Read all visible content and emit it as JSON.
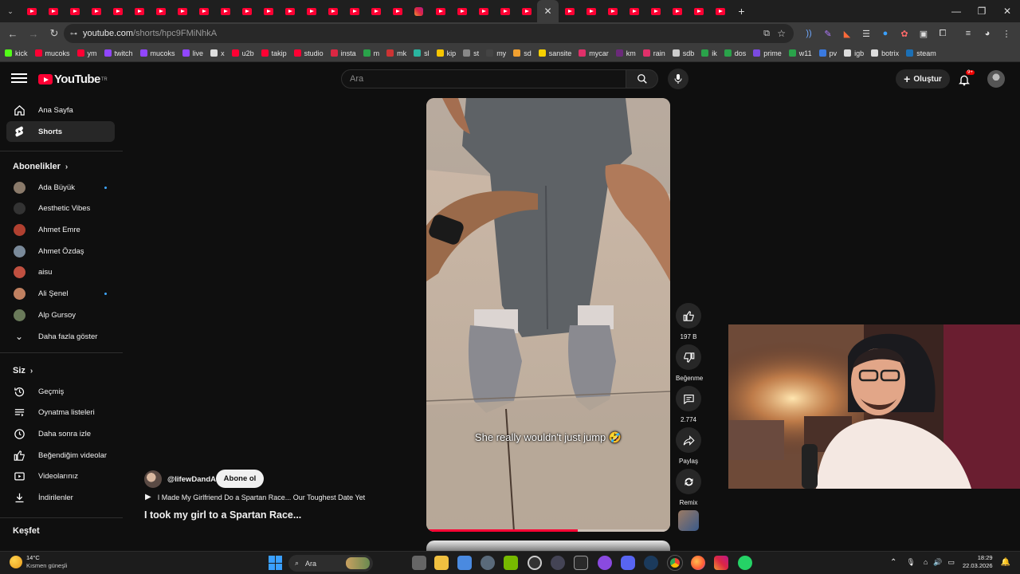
{
  "browser": {
    "tab_count_youtube": 32,
    "active_tab_close": "✕",
    "new_tab": "+",
    "window_controls": {
      "minimize": "—",
      "maximize": "❐",
      "close": "✕"
    },
    "url_host": "youtube.com",
    "url_path": "/shorts/hpc9FMiNhkA"
  },
  "bookmarks": [
    {
      "label": "kick",
      "color": "#53fc18"
    },
    {
      "label": "mucoks",
      "color": "#ff0033"
    },
    {
      "label": "ym",
      "color": "#ff0033"
    },
    {
      "label": "twitch",
      "color": "#9146ff"
    },
    {
      "label": "mucoks",
      "color": "#9146ff"
    },
    {
      "label": "live",
      "color": "#9146ff"
    },
    {
      "label": "x",
      "color": "#dddddd"
    },
    {
      "label": "u2b",
      "color": "#ff0033"
    },
    {
      "label": "takip",
      "color": "#ff0033"
    },
    {
      "label": "studio",
      "color": "#ff0033"
    },
    {
      "label": "insta",
      "color": "#dc2743"
    },
    {
      "label": "m",
      "color": "#2aa34a"
    },
    {
      "label": "mk",
      "color": "#c33"
    },
    {
      "label": "sl",
      "color": "#2ab5a0"
    },
    {
      "label": "kip",
      "color": "#f7c600"
    },
    {
      "label": "st",
      "color": "#888888"
    },
    {
      "label": "my",
      "color": "#444444"
    },
    {
      "label": "sd",
      "color": "#f0a030"
    },
    {
      "label": "sansite",
      "color": "#f7d100"
    },
    {
      "label": "mycar",
      "color": "#e0306a"
    },
    {
      "label": "km",
      "color": "#6b2a7a"
    },
    {
      "label": "rain",
      "color": "#e0306a"
    },
    {
      "label": "sdb",
      "color": "#cccccc"
    },
    {
      "label": "ik",
      "color": "#2aa34a"
    },
    {
      "label": "dos",
      "color": "#2aa34a"
    },
    {
      "label": "prime",
      "color": "#7a4ae0"
    },
    {
      "label": "w11",
      "color": "#2aa34a"
    },
    {
      "label": "pv",
      "color": "#3a7ae0"
    },
    {
      "label": "igb",
      "color": "#dddddd"
    },
    {
      "label": "botrix",
      "color": "#dddddd"
    },
    {
      "label": "steam",
      "color": "#1b6fb5"
    }
  ],
  "header": {
    "logo_text": "YouTube",
    "logo_region": "TR",
    "search_placeholder": "Ara",
    "create_label": "Oluştur",
    "notif_badge": "9+"
  },
  "sidebar": {
    "main": [
      {
        "label": "Ana Sayfa",
        "icon": "home-icon"
      },
      {
        "label": "Shorts",
        "icon": "shorts-icon",
        "selected": true
      }
    ],
    "subs_title": "Abonelikler",
    "subs": [
      {
        "label": "Ada Büyük",
        "new": true,
        "color": "#8a7a6a"
      },
      {
        "label": "Aesthetic Vibes",
        "new": false,
        "color": "#333333"
      },
      {
        "label": "Ahmet Emre",
        "new": false,
        "color": "#b04030"
      },
      {
        "label": "Ahmet Özdaş",
        "new": false,
        "color": "#7a8a9a"
      },
      {
        "label": "aisu",
        "new": false,
        "color": "#c05040"
      },
      {
        "label": "Ali Şenel",
        "new": true,
        "color": "#c08060"
      },
      {
        "label": "Alp Gursoy",
        "new": false,
        "color": "#6a7a5a"
      }
    ],
    "show_more": "Daha fazla göster",
    "you_title": "Siz",
    "you_items": [
      {
        "label": "Geçmiş",
        "icon": "history-icon"
      },
      {
        "label": "Oynatma listeleri",
        "icon": "playlists-icon"
      },
      {
        "label": "Daha sonra izle",
        "icon": "clock-icon"
      },
      {
        "label": "Beğendiğim videolar",
        "icon": "like-icon"
      },
      {
        "label": "Videolarınız",
        "icon": "your-videos-icon"
      },
      {
        "label": "İndirilenler",
        "icon": "download-icon"
      }
    ],
    "explore_title": "Keşfet"
  },
  "video": {
    "caption": "She really wouldn't just jump 🤣",
    "progress": 0.62
  },
  "actions": {
    "like_count": "197 B",
    "dislike_label": "Beğenme",
    "comment_count": "2.774",
    "share_label": "Paylaş",
    "remix_label": "Remix"
  },
  "channel": {
    "handle": "@lifewDandA",
    "subscribe_label": "Abone ol",
    "playlist_title": "I Made My Girlfriend Do a Spartan Race... Our Toughest Date Yet",
    "title": "I took my girl to a Spartan Race..."
  },
  "taskbar": {
    "temp": "14°C",
    "weather": "Kısmen güneşli",
    "search": "Ara",
    "time": "18:29",
    "date": "22.03.2026"
  }
}
